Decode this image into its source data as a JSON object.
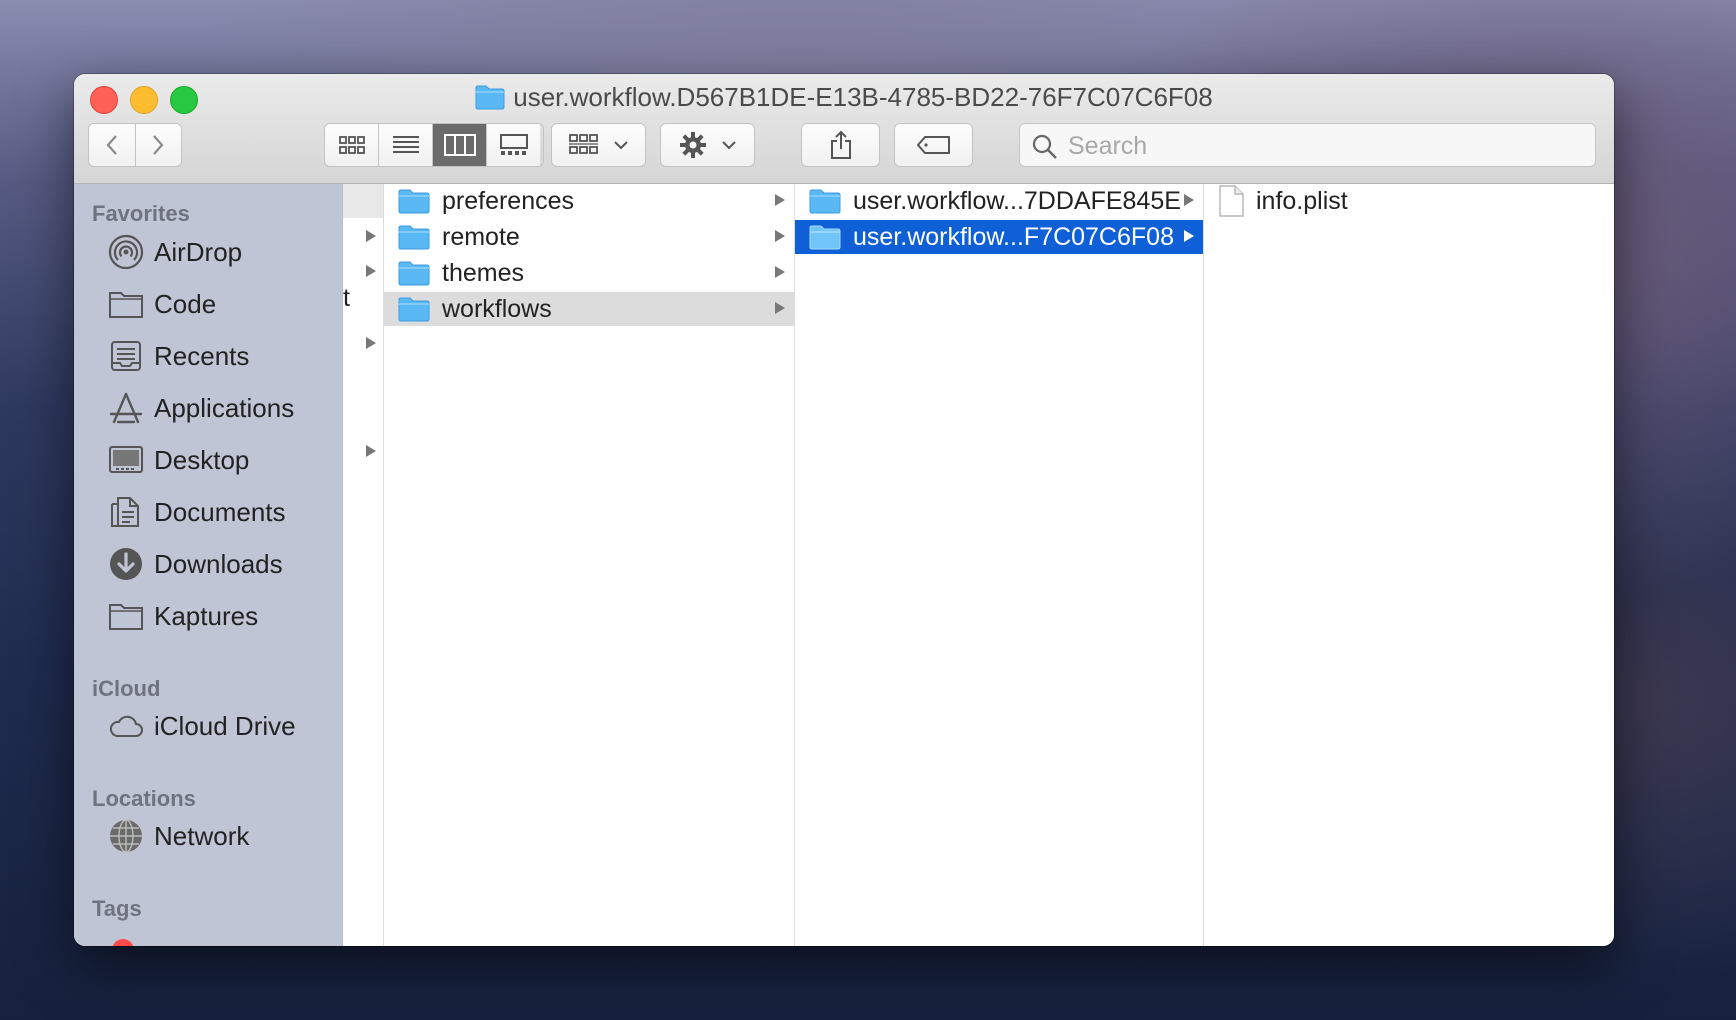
{
  "window": {
    "title": "user.workflow.D567B1DE-E13B-4785-BD22-76F7C07C6F08"
  },
  "toolbar": {
    "back_icon": "chevron-left-icon",
    "forward_icon": "chevron-right-icon",
    "view_modes": [
      "icon-view",
      "list-view",
      "column-view",
      "gallery-view"
    ],
    "active_view": "column-view",
    "group_icon": "group-icon",
    "action_icon": "gear-icon",
    "share_icon": "share-icon",
    "tag_icon": "tag-icon",
    "search_placeholder": "Search"
  },
  "sidebar": {
    "favorites_header": "Favorites",
    "favorites": [
      {
        "label": "AirDrop",
        "icon": "airdrop-icon"
      },
      {
        "label": "Code",
        "icon": "folder-icon"
      },
      {
        "label": "Recents",
        "icon": "recents-icon"
      },
      {
        "label": "Applications",
        "icon": "applications-icon"
      },
      {
        "label": "Desktop",
        "icon": "desktop-icon"
      },
      {
        "label": "Documents",
        "icon": "documents-icon"
      },
      {
        "label": "Downloads",
        "icon": "downloads-icon"
      },
      {
        "label": "Kaptures",
        "icon": "folder-icon"
      }
    ],
    "icloud_header": "iCloud",
    "icloud": [
      {
        "label": "iCloud Drive",
        "icon": "cloud-icon"
      }
    ],
    "locations_header": "Locations",
    "locations": [
      {
        "label": "Network",
        "icon": "network-icon"
      }
    ],
    "tags_header": "Tags"
  },
  "columns": {
    "col0_fragment": "t",
    "col1": [
      {
        "label": "preferences",
        "selected": false
      },
      {
        "label": "remote",
        "selected": false
      },
      {
        "label": "themes",
        "selected": false
      },
      {
        "label": "workflows",
        "selected": true
      }
    ],
    "col2": [
      {
        "label": "user.workflow...7DDAFE845E",
        "selected": false
      },
      {
        "label": "user.workflow...F7C07C6F08",
        "selected": true
      }
    ],
    "col3": [
      {
        "label": "info.plist",
        "icon": "file-icon"
      }
    ]
  },
  "colors": {
    "selection_blue": "#0f5fd7",
    "folder_blue": "#5ab8f5",
    "sidebar_bg": "#c0c5d6"
  }
}
